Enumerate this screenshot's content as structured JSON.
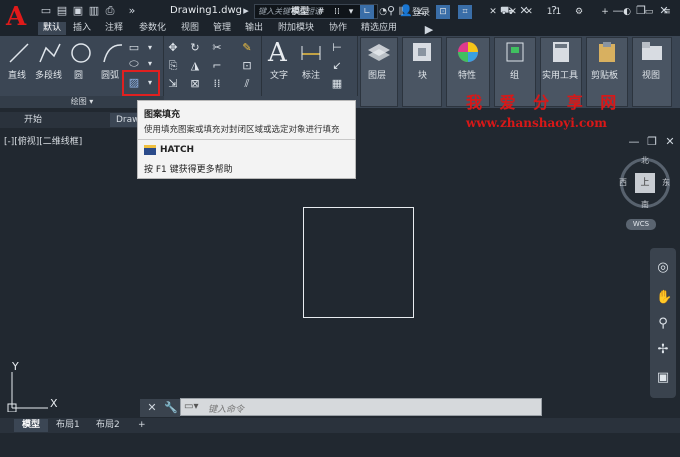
{
  "title_bar": {
    "doc_title": "Drawing1.dwg",
    "search_placeholder": "键入关键字或短语",
    "login_label": "登录"
  },
  "ribbon_tabs": [
    "默认",
    "插入",
    "注释",
    "参数化",
    "视图",
    "管理",
    "输出",
    "附加模块",
    "协作",
    "精选应用"
  ],
  "active_tab": "默认",
  "draw_panel": {
    "tools": [
      "直线",
      "多段线",
      "圆",
      "圆弧"
    ],
    "footer": "绘图"
  },
  "big_tools": [
    "文字",
    "标注",
    "图层",
    "块",
    "特性",
    "组",
    "实用工具",
    "剪贴板",
    "视图"
  ],
  "tooltip": {
    "title": "图案填充",
    "description": "使用填充图案或填充对封闭区域或选定对象进行填充",
    "command": "HATCH",
    "help": "按 F1 键获得更多帮助"
  },
  "file_tabs": [
    "开始",
    "Drawing1"
  ],
  "viewport_label": "[-][俯视][二维线框]",
  "viewcube": {
    "north": "北",
    "south": "南",
    "west": "西",
    "east": "东",
    "face": "上",
    "wcs": "WCS"
  },
  "ucs": {
    "x": "X",
    "y": "Y"
  },
  "command_placeholder": "键入命令",
  "layout_tabs": [
    "模型",
    "布局1",
    "布局2"
  ],
  "status": {
    "model_label": "模型",
    "scale": "1:1"
  },
  "watermark": {
    "text": "我 爱 分 享 网",
    "url": "www.zhanshaoyi.com"
  },
  "colors": {
    "logo": "#e11a1a",
    "highlight": "#e02020",
    "watermark": "#d81818"
  }
}
